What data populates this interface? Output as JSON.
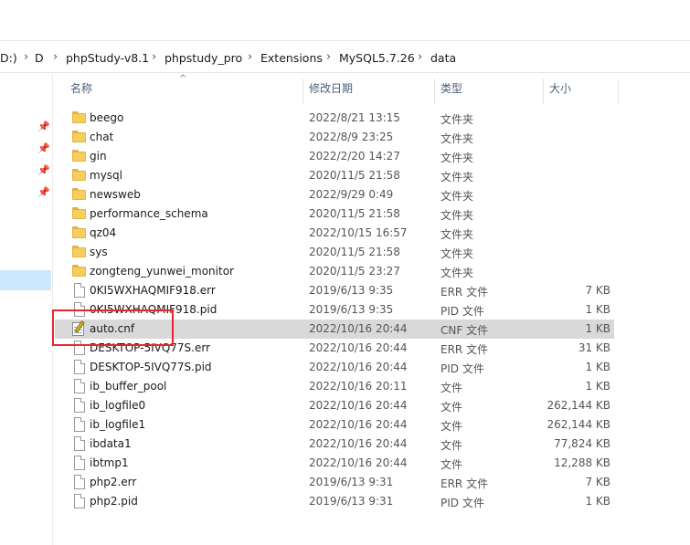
{
  "breadcrumb": {
    "items": [
      "D:)",
      "D",
      "phpStudy-v8.1",
      "phpstudy_pro",
      "Extensions",
      "MySQL5.7.26",
      "data"
    ]
  },
  "columns": {
    "name": "名称",
    "modified": "修改日期",
    "type": "类型",
    "size": "大小"
  },
  "files": [
    {
      "name": "beego",
      "modified": "2022/8/21 13:15",
      "type": "文件夹",
      "size": "",
      "icon": "folder-icon"
    },
    {
      "name": "chat",
      "modified": "2022/8/9 23:25",
      "type": "文件夹",
      "size": "",
      "icon": "folder-icon"
    },
    {
      "name": "gin",
      "modified": "2022/2/20 14:27",
      "type": "文件夹",
      "size": "",
      "icon": "folder-icon"
    },
    {
      "name": "mysql",
      "modified": "2020/11/5 21:58",
      "type": "文件夹",
      "size": "",
      "icon": "folder-icon"
    },
    {
      "name": "newsweb",
      "modified": "2022/9/29 0:49",
      "type": "文件夹",
      "size": "",
      "icon": "folder-icon"
    },
    {
      "name": "performance_schema",
      "modified": "2020/11/5 21:58",
      "type": "文件夹",
      "size": "",
      "icon": "folder-icon"
    },
    {
      "name": "qz04",
      "modified": "2022/10/15 16:57",
      "type": "文件夹",
      "size": "",
      "icon": "folder-icon"
    },
    {
      "name": "sys",
      "modified": "2020/11/5 21:58",
      "type": "文件夹",
      "size": "",
      "icon": "folder-icon"
    },
    {
      "name": "zongteng_yunwei_monitor",
      "modified": "2020/11/5 23:27",
      "type": "文件夹",
      "size": "",
      "icon": "folder-icon"
    },
    {
      "name": "0KI5WXHAQMIF918.err",
      "modified": "2019/6/13 9:35",
      "type": "ERR 文件",
      "size": "7 KB",
      "icon": "file-icon"
    },
    {
      "name": "0KI5WXHAQMIF918.pid",
      "modified": "2019/6/13 9:35",
      "type": "PID 文件",
      "size": "1 KB",
      "icon": "file-icon"
    },
    {
      "name": "auto.cnf",
      "modified": "2022/10/16 20:44",
      "type": "CNF 文件",
      "size": "1 KB",
      "icon": "config-file-icon"
    },
    {
      "name": "DESKTOP-5IVQ77S.err",
      "modified": "2022/10/16 20:44",
      "type": "ERR 文件",
      "size": "31 KB",
      "icon": "file-icon"
    },
    {
      "name": "DESKTOP-5IVQ77S.pid",
      "modified": "2022/10/16 20:44",
      "type": "PID 文件",
      "size": "1 KB",
      "icon": "file-icon"
    },
    {
      "name": "ib_buffer_pool",
      "modified": "2022/10/16 20:11",
      "type": "文件",
      "size": "1 KB",
      "icon": "file-icon"
    },
    {
      "name": "ib_logfile0",
      "modified": "2022/10/16 20:44",
      "type": "文件",
      "size": "262,144 KB",
      "icon": "file-icon"
    },
    {
      "name": "ib_logfile1",
      "modified": "2022/10/16 20:44",
      "type": "文件",
      "size": "262,144 KB",
      "icon": "file-icon"
    },
    {
      "name": "ibdata1",
      "modified": "2022/10/16 20:44",
      "type": "文件",
      "size": "77,824 KB",
      "icon": "file-icon"
    },
    {
      "name": "ibtmp1",
      "modified": "2022/10/16 20:44",
      "type": "文件",
      "size": "12,288 KB",
      "icon": "file-icon"
    },
    {
      "name": "php2.err",
      "modified": "2019/6/13 9:31",
      "type": "ERR 文件",
      "size": "7 KB",
      "icon": "file-icon"
    },
    {
      "name": "php2.pid",
      "modified": "2019/6/13 9:31",
      "type": "PID 文件",
      "size": "1 KB",
      "icon": "file-icon"
    }
  ],
  "selected_file": "auto.cnf",
  "colors": {
    "selection": "#d9d9d9",
    "highlight_box": "#e8262b",
    "folder": "#f7ce5b"
  }
}
